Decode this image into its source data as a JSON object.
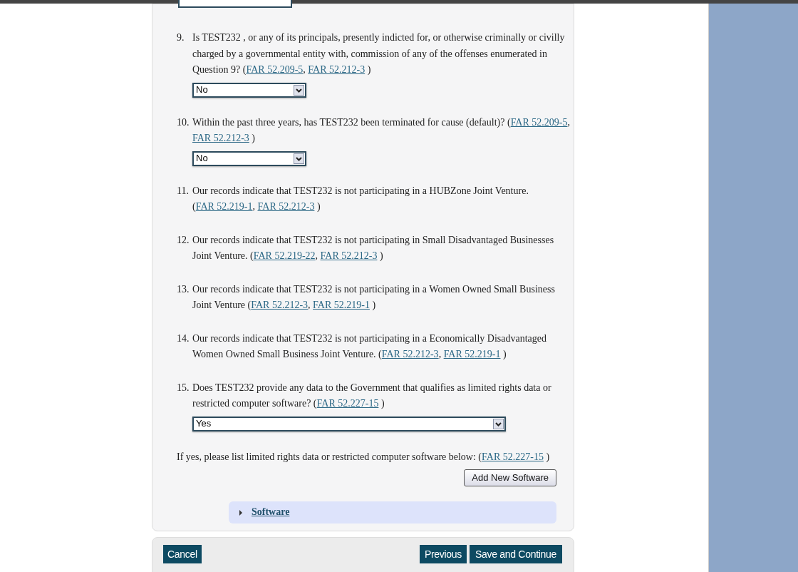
{
  "questions": [
    {
      "number": "9.",
      "parts": [
        {
          "kind": "text",
          "text": "Is TEST232 , or any of its principals, presently indicted for, or otherwise criminally or civilly charged by a governmental entity with, commission of any of the offenses enumerated in Question 9? ("
        },
        {
          "kind": "link",
          "text": "FAR 52.209-5"
        },
        {
          "kind": "text",
          "text": ", "
        },
        {
          "kind": "link",
          "text": "FAR 52.212-3"
        },
        {
          "kind": "text",
          "text": " )"
        }
      ],
      "dropdown": {
        "value": "No",
        "kind": "short"
      }
    },
    {
      "number": "10.",
      "parts": [
        {
          "kind": "text",
          "text": "Within the past three years, has TEST232 been terminated for cause (default)? ("
        },
        {
          "kind": "link",
          "text": "FAR 52.209-5"
        },
        {
          "kind": "text",
          "text": ", "
        },
        {
          "kind": "link",
          "text": "FAR 52.212-3"
        },
        {
          "kind": "text",
          "text": " )"
        }
      ],
      "dropdown": {
        "value": "No",
        "kind": "short"
      }
    },
    {
      "number": "11.",
      "parts": [
        {
          "kind": "text",
          "text": "Our records indicate that TEST232 is not participating in a HUBZone Joint Venture. ("
        },
        {
          "kind": "link",
          "text": "FAR 52.219-1"
        },
        {
          "kind": "text",
          "text": ", "
        },
        {
          "kind": "link",
          "text": "FAR 52.212-3"
        },
        {
          "kind": "text",
          "text": " )"
        }
      ]
    },
    {
      "number": "12.",
      "parts": [
        {
          "kind": "text",
          "text": "Our records indicate that TEST232 is not participating in Small Disadvantaged Businesses Joint Venture. ("
        },
        {
          "kind": "link",
          "text": "FAR 52.219-22"
        },
        {
          "kind": "text",
          "text": ", "
        },
        {
          "kind": "link",
          "text": "FAR 52.212-3"
        },
        {
          "kind": "text",
          "text": " )"
        }
      ]
    },
    {
      "number": "13.",
      "parts": [
        {
          "kind": "text",
          "text": "Our records indicate that TEST232 is not participating in a Women Owned Small Business Joint Venture ("
        },
        {
          "kind": "link",
          "text": "FAR 52.212-3"
        },
        {
          "kind": "text",
          "text": ", "
        },
        {
          "kind": "link",
          "text": "FAR 52.219-1"
        },
        {
          "kind": "text",
          "text": " )"
        }
      ]
    },
    {
      "number": "14.",
      "parts": [
        {
          "kind": "text",
          "text": "Our records indicate that TEST232 is not participating in a Economically Disadvantaged Women Owned Small Business Joint Venture. ("
        },
        {
          "kind": "link",
          "text": "FAR 52.212-3"
        },
        {
          "kind": "text",
          "text": ", "
        },
        {
          "kind": "link",
          "text": "FAR 52.219-1"
        },
        {
          "kind": "text",
          "text": " )"
        }
      ]
    },
    {
      "number": "15.",
      "parts": [
        {
          "kind": "text",
          "text": "Does TEST232 provide any data to the Government that qualifies as limited rights data or restricted computer software? ("
        },
        {
          "kind": "link",
          "text": "FAR 52.227-15"
        },
        {
          "kind": "text",
          "text": " )"
        }
      ],
      "dropdown": {
        "value": "Yes",
        "kind": "long"
      }
    }
  ],
  "note": {
    "parts": [
      {
        "kind": "text",
        "text": "If yes, please list limited rights data or restricted computer software below: ("
      },
      {
        "kind": "link",
        "text": "FAR 52.227-15"
      },
      {
        "kind": "text",
        "text": " )"
      }
    ]
  },
  "add_button": "Add New Software",
  "section": {
    "label": "Software",
    "expanded": false
  },
  "footer": {
    "cancel": "Cancel",
    "previous": "Previous",
    "save": "Save and Continue"
  }
}
